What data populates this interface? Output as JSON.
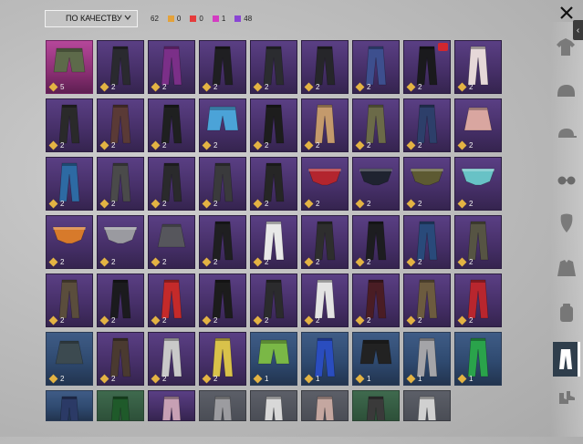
{
  "toolbar": {
    "sort_label": "ПО КАЧЕСТВУ",
    "total_count": "62",
    "rarity_counts": [
      {
        "color": "#e4a23a",
        "count": "0"
      },
      {
        "color": "#e53b3b",
        "count": "0"
      },
      {
        "color": "#d43cc2",
        "count": "1"
      },
      {
        "color": "#8a45d4",
        "count": "48"
      }
    ]
  },
  "colors": {
    "accent": "#e3b343"
  },
  "categories": [
    {
      "icon": "shirt-icon",
      "active": false
    },
    {
      "icon": "helmet-icon",
      "active": false
    },
    {
      "icon": "cap-icon",
      "active": false
    },
    {
      "icon": "glasses-icon",
      "active": false
    },
    {
      "icon": "mask-icon",
      "active": false
    },
    {
      "icon": "jacket-icon",
      "active": false
    },
    {
      "icon": "backpack-icon",
      "active": false
    },
    {
      "icon": "pants-icon",
      "active": true
    },
    {
      "icon": "shoes-icon",
      "active": false
    }
  ],
  "items": [
    {
      "qty": "5",
      "rarity": "pink",
      "kind": "shorts",
      "color": "#5d6a4a"
    },
    {
      "qty": "2",
      "rarity": "purple",
      "kind": "pants",
      "color": "#2a2a2f"
    },
    {
      "qty": "2",
      "rarity": "purple",
      "kind": "pants",
      "color": "#7b2f88"
    },
    {
      "qty": "2",
      "rarity": "purple",
      "kind": "pants",
      "color": "#1f1f22"
    },
    {
      "qty": "2",
      "rarity": "purple",
      "kind": "pants",
      "color": "#2b2c30"
    },
    {
      "qty": "2",
      "rarity": "purple",
      "kind": "pants",
      "color": "#26262a"
    },
    {
      "qty": "2",
      "rarity": "purple",
      "kind": "pants",
      "color": "#3d4f8e"
    },
    {
      "qty": "2",
      "rarity": "purple",
      "kind": "pants",
      "color": "#1a1a1d",
      "badge": true
    },
    {
      "qty": "2",
      "rarity": "purple",
      "kind": "pants",
      "color": "#e6d8d8"
    },
    {
      "qty": "2",
      "rarity": "purple",
      "kind": "pants",
      "color": "#2a2a2a"
    },
    {
      "qty": "2",
      "rarity": "purple",
      "kind": "pants",
      "color": "#5a3a36"
    },
    {
      "qty": "2",
      "rarity": "purple",
      "kind": "pants",
      "color": "#1f2020"
    },
    {
      "qty": "2",
      "rarity": "purple",
      "kind": "shorts",
      "color": "#4ba3d8"
    },
    {
      "qty": "2",
      "rarity": "purple",
      "kind": "pants",
      "color": "#1d1d1d"
    },
    {
      "qty": "2",
      "rarity": "purple",
      "kind": "pants",
      "color": "#c49a6c"
    },
    {
      "qty": "2",
      "rarity": "purple",
      "kind": "pants",
      "color": "#6b6a48"
    },
    {
      "qty": "2",
      "rarity": "purple",
      "kind": "pants",
      "color": "#2d3f6a"
    },
    {
      "qty": "2",
      "rarity": "purple",
      "kind": "skirt",
      "color": "#d9a6a0"
    },
    {
      "qty": "2",
      "rarity": "purple",
      "kind": "pants",
      "color": "#2d6aa3"
    },
    {
      "qty": "2",
      "rarity": "purple",
      "kind": "pants",
      "color": "#4a4a4a"
    },
    {
      "qty": "2",
      "rarity": "purple",
      "kind": "pants",
      "color": "#2a2a2c"
    },
    {
      "qty": "2",
      "rarity": "purple",
      "kind": "pants",
      "color": "#3a3a3c"
    },
    {
      "qty": "2",
      "rarity": "purple",
      "kind": "pants",
      "color": "#262626"
    },
    {
      "qty": "2",
      "rarity": "purple",
      "kind": "briefs",
      "color": "#b3252e"
    },
    {
      "qty": "2",
      "rarity": "purple",
      "kind": "briefs",
      "color": "#1f2330"
    },
    {
      "qty": "2",
      "rarity": "purple",
      "kind": "briefs",
      "color": "#5d5a32"
    },
    {
      "qty": "2",
      "rarity": "purple",
      "kind": "briefs",
      "color": "#68c2c6"
    },
    {
      "qty": "2",
      "rarity": "purple",
      "kind": "briefs",
      "color": "#d77a2b"
    },
    {
      "qty": "2",
      "rarity": "purple",
      "kind": "briefs",
      "color": "#9a9aa0"
    },
    {
      "qty": "2",
      "rarity": "purple",
      "kind": "skirt",
      "color": "#56565c"
    },
    {
      "qty": "2",
      "rarity": "purple",
      "kind": "pants",
      "color": "#1f1f21"
    },
    {
      "qty": "2",
      "rarity": "purple",
      "kind": "pants",
      "color": "#e8e8e8"
    },
    {
      "qty": "2",
      "rarity": "purple",
      "kind": "pants",
      "color": "#2e2e2e"
    },
    {
      "qty": "2",
      "rarity": "purple",
      "kind": "pants",
      "color": "#1d1d20"
    },
    {
      "qty": "2",
      "rarity": "purple",
      "kind": "pants",
      "color": "#294a7a"
    },
    {
      "qty": "2",
      "rarity": "purple",
      "kind": "pants",
      "color": "#565443"
    },
    {
      "qty": "2",
      "rarity": "purple",
      "kind": "pants",
      "color": "#5a4d3c"
    },
    {
      "qty": "2",
      "rarity": "purple",
      "kind": "pants",
      "color": "#1b1b1e"
    },
    {
      "qty": "2",
      "rarity": "purple",
      "kind": "pants",
      "color": "#c42a2a"
    },
    {
      "qty": "2",
      "rarity": "purple",
      "kind": "pants",
      "color": "#1c1c1c"
    },
    {
      "qty": "2",
      "rarity": "purple",
      "kind": "pants",
      "color": "#2b2b2d"
    },
    {
      "qty": "2",
      "rarity": "purple",
      "kind": "pants",
      "color": "#e3e3e3"
    },
    {
      "qty": "2",
      "rarity": "purple",
      "kind": "pants",
      "color": "#4a1d24"
    },
    {
      "qty": "2",
      "rarity": "purple",
      "kind": "pants",
      "color": "#6c5b3f"
    },
    {
      "qty": "2",
      "rarity": "purple",
      "kind": "pants",
      "color": "#b8262e"
    },
    {
      "qty": "2",
      "rarity": "blue",
      "kind": "skirt",
      "color": "#3c4a50"
    },
    {
      "qty": "2",
      "rarity": "purple",
      "kind": "pants",
      "color": "#4a3a30"
    },
    {
      "qty": "2",
      "rarity": "purple",
      "kind": "pants",
      "color": "#c9c9c9"
    },
    {
      "qty": "2",
      "rarity": "purple",
      "kind": "pants",
      "color": "#d9c24a"
    },
    {
      "qty": "1",
      "rarity": "blue",
      "kind": "shorts",
      "color": "#7ab846"
    },
    {
      "qty": "1",
      "rarity": "blue",
      "kind": "pants",
      "color": "#2a4dbf"
    },
    {
      "qty": "1",
      "rarity": "blue",
      "kind": "shorts",
      "color": "#222222"
    },
    {
      "qty": "1",
      "rarity": "blue",
      "kind": "pants",
      "color": "#a4a4a8"
    },
    {
      "qty": "1",
      "rarity": "blue",
      "kind": "pants",
      "color": "#2aa34b"
    },
    {
      "qty": "",
      "rarity": "blue",
      "kind": "pants",
      "color": "#2b3a66",
      "cut": true
    },
    {
      "qty": "",
      "rarity": "green",
      "kind": "pants",
      "color": "#1f5a2a",
      "cut": true
    },
    {
      "qty": "",
      "rarity": "purple",
      "kind": "pants",
      "color": "#c7a0b4",
      "cut": true
    },
    {
      "qty": "",
      "rarity": "grey",
      "kind": "pants",
      "color": "#9c9ca0",
      "cut": true
    },
    {
      "qty": "",
      "rarity": "grey",
      "kind": "pants",
      "color": "#d8d8d8",
      "cut": true
    },
    {
      "qty": "",
      "rarity": "grey",
      "kind": "pants",
      "color": "#c4a7a0",
      "cut": true
    },
    {
      "qty": "",
      "rarity": "green",
      "kind": "pants",
      "color": "#3a3a3a",
      "cut": true
    },
    {
      "qty": "",
      "rarity": "grey",
      "kind": "pants",
      "color": "#d0d0d0",
      "cut": true
    }
  ]
}
